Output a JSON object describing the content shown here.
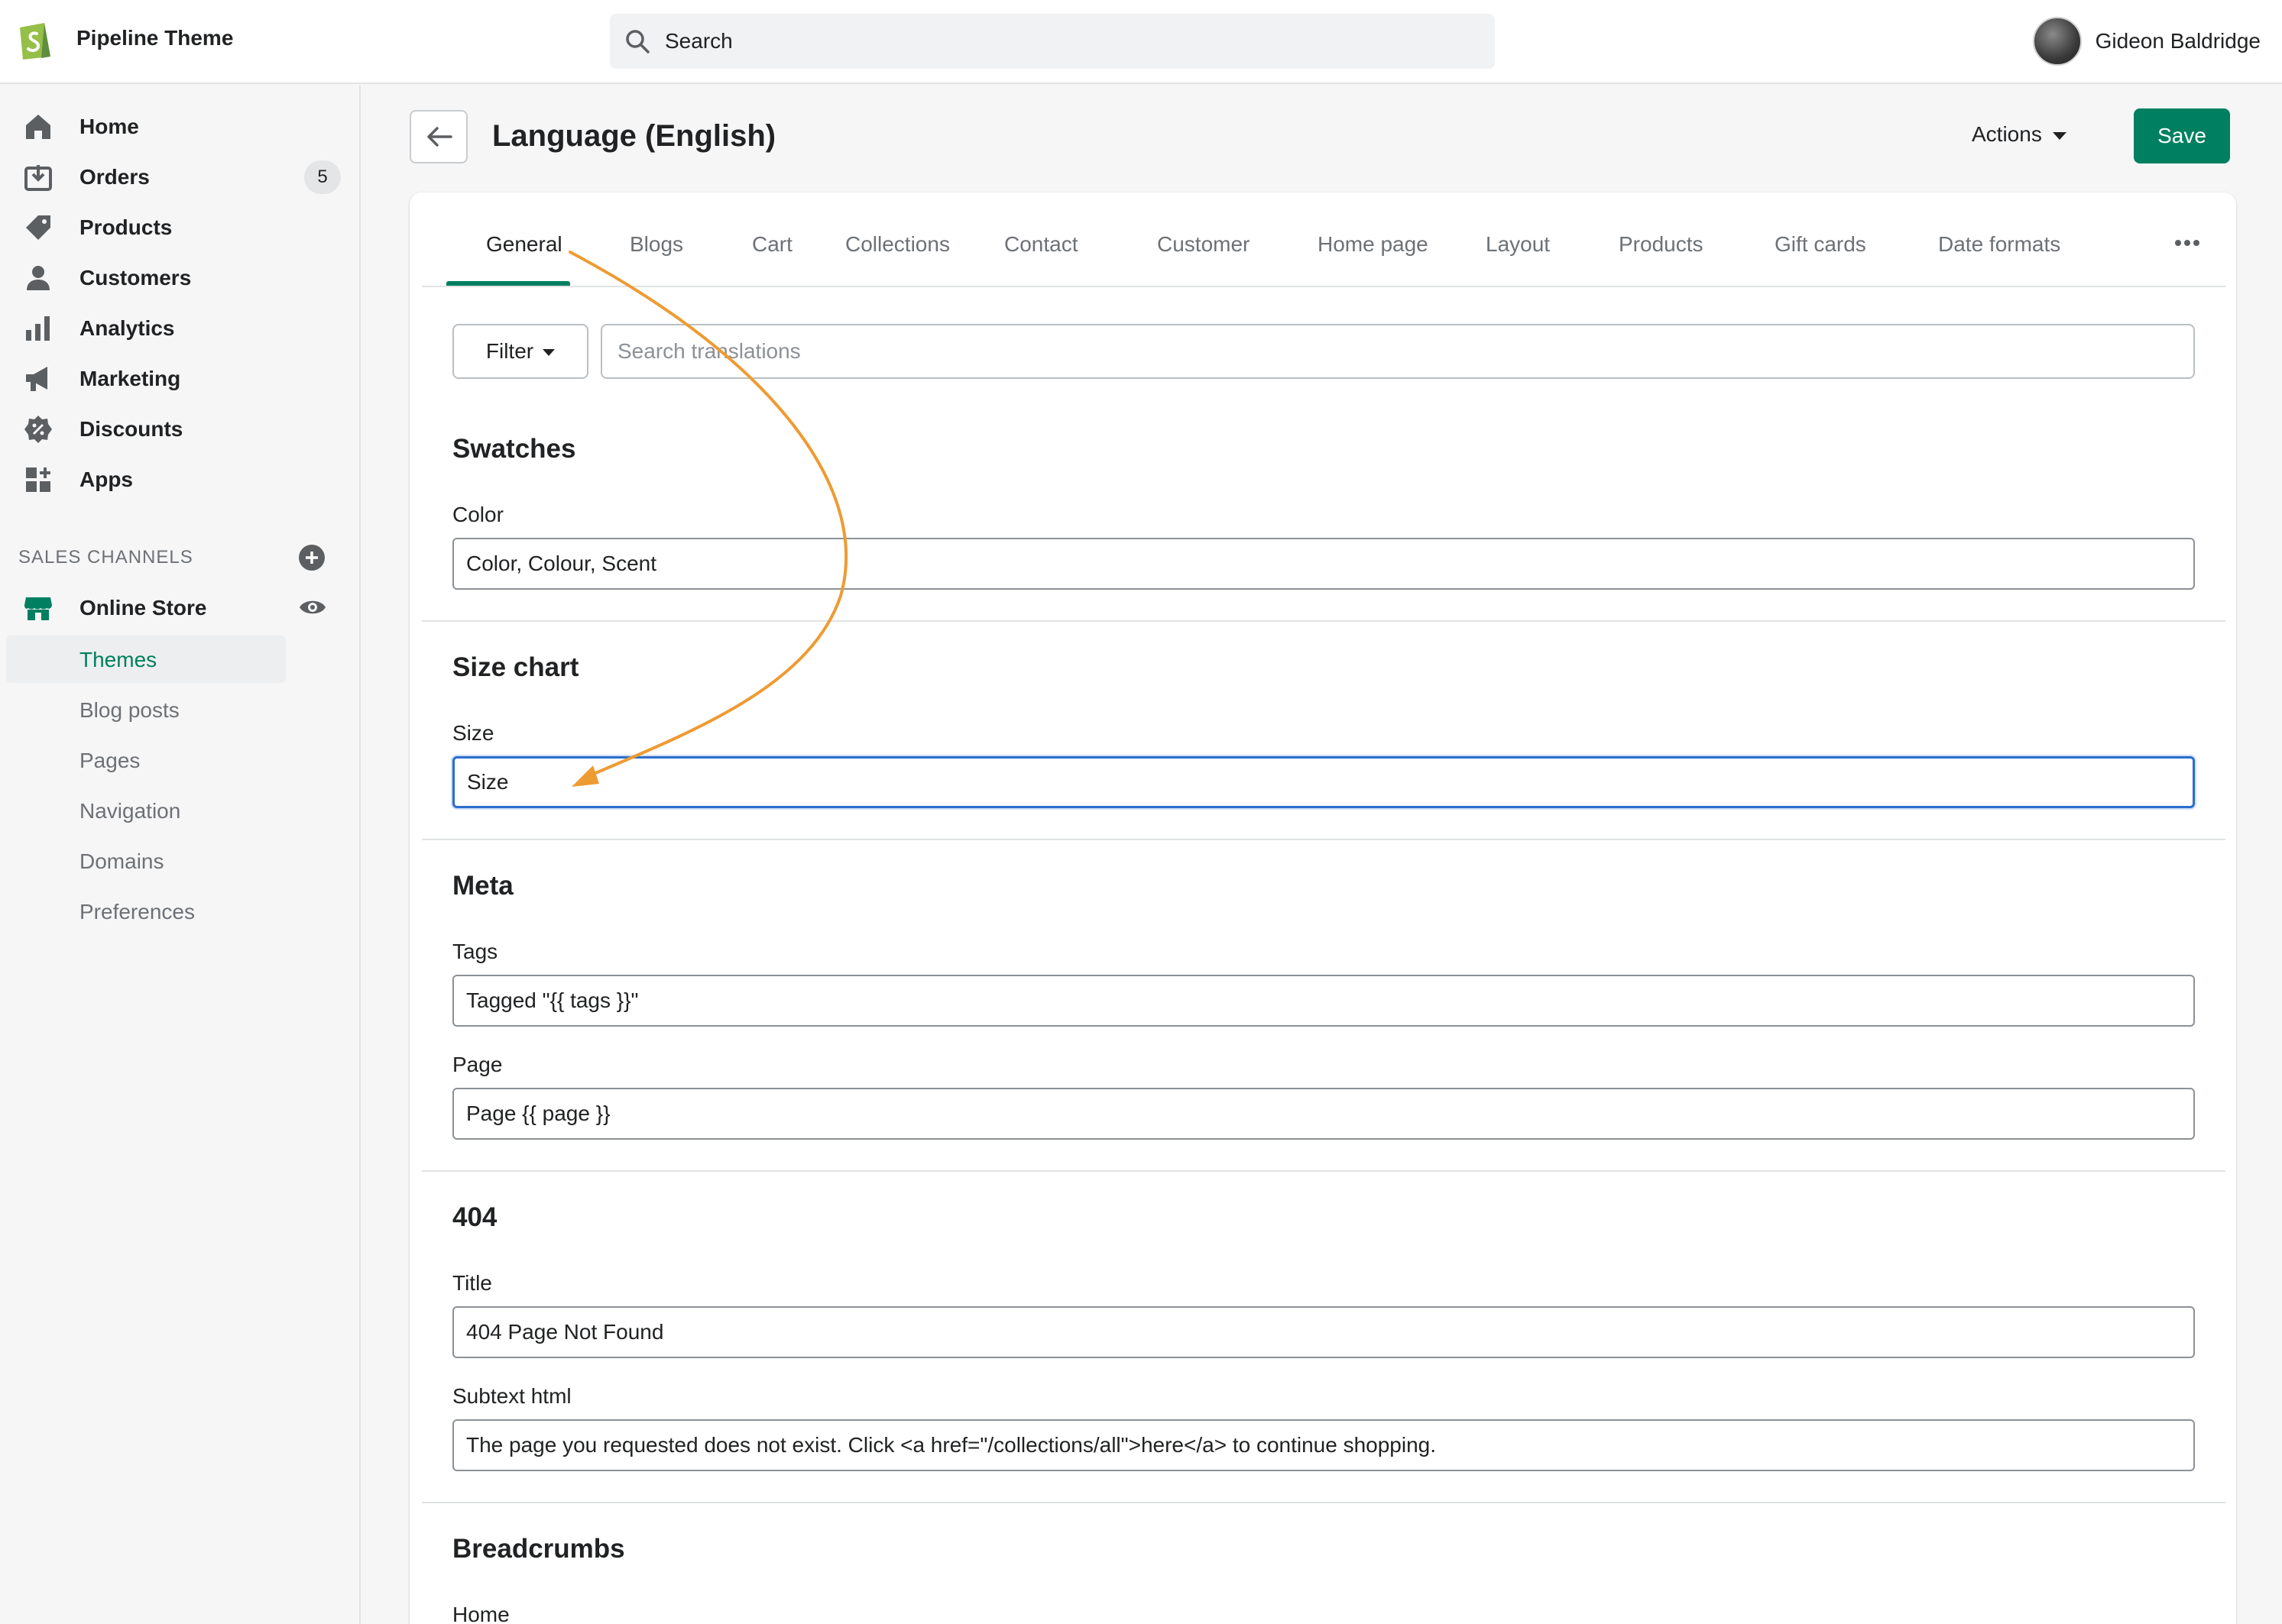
{
  "topbar": {
    "store_name": "Pipeline Theme",
    "search_placeholder": "Search",
    "user_name": "Gideon Baldridge"
  },
  "sidebar": {
    "items": [
      {
        "label": "Home",
        "icon": "home-icon"
      },
      {
        "label": "Orders",
        "icon": "orders-icon",
        "badge": "5"
      },
      {
        "label": "Products",
        "icon": "tag-icon"
      },
      {
        "label": "Customers",
        "icon": "person-icon"
      },
      {
        "label": "Analytics",
        "icon": "bar-chart-icon"
      },
      {
        "label": "Marketing",
        "icon": "megaphone-icon"
      },
      {
        "label": "Discounts",
        "icon": "discount-icon"
      },
      {
        "label": "Apps",
        "icon": "apps-icon"
      }
    ],
    "sales_channels_label": "SALES CHANNELS",
    "online_store_label": "Online Store",
    "sub_items": [
      {
        "label": "Themes",
        "active": true
      },
      {
        "label": "Blog posts"
      },
      {
        "label": "Pages"
      },
      {
        "label": "Navigation"
      },
      {
        "label": "Domains"
      },
      {
        "label": "Preferences"
      }
    ]
  },
  "header": {
    "title": "Language (English)",
    "actions_label": "Actions",
    "save_label": "Save"
  },
  "tabs": [
    "General",
    "Blogs",
    "Cart",
    "Collections",
    "Contact",
    "Customer",
    "Home page",
    "Layout",
    "Products",
    "Gift cards",
    "Date formats"
  ],
  "filter": {
    "button_label": "Filter",
    "search_placeholder": "Search translations"
  },
  "sections": {
    "swatches": {
      "title": "Swatches",
      "color_label": "Color",
      "color_value": "Color, Colour, Scent"
    },
    "size_chart": {
      "title": "Size chart",
      "size_label": "Size",
      "size_value": "Size"
    },
    "meta": {
      "title": "Meta",
      "tags_label": "Tags",
      "tags_value": "Tagged \"{{ tags }}\"",
      "page_label": "Page",
      "page_value": "Page {{ page }}"
    },
    "not_found": {
      "title": "404",
      "title_label": "Title",
      "title_value": "404 Page Not Found",
      "subtext_label": "Subtext html",
      "subtext_value": "The page you requested does not exist. Click <a href=\"/collections/all\">here</a> to continue shopping."
    },
    "breadcrumbs": {
      "title": "Breadcrumbs",
      "home_label": "Home"
    }
  },
  "colors": {
    "brand_green": "#008060",
    "active_nav_green": "#007f5f",
    "focus_blue": "#2c6ecb",
    "annotation_orange": "#ee9b33"
  }
}
